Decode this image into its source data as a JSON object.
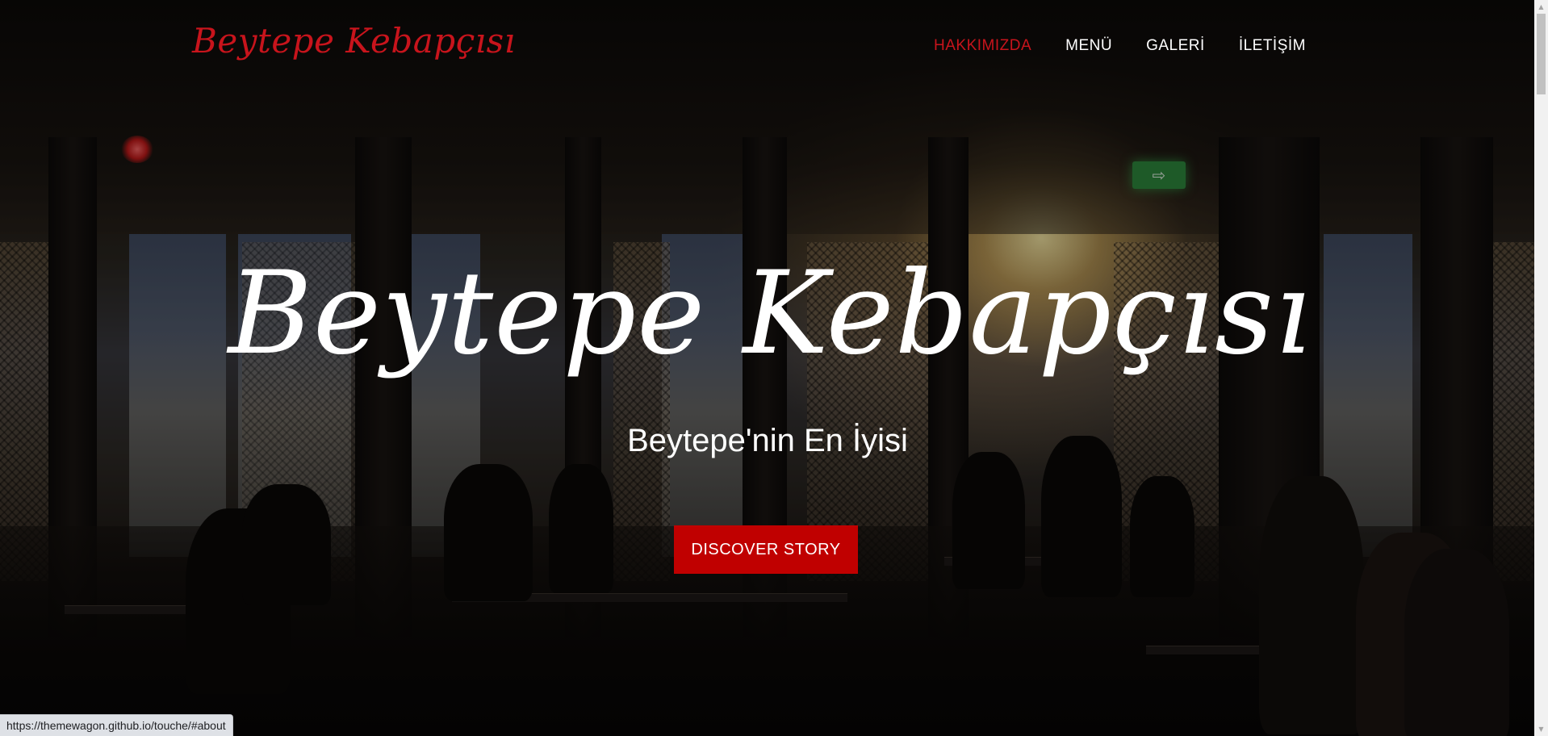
{
  "brand": {
    "name": "Beytepe Kebapçısı"
  },
  "nav": {
    "items": [
      {
        "label": "HAKKIMIZDA",
        "active": true
      },
      {
        "label": "MENÜ",
        "active": false
      },
      {
        "label": "GALERİ",
        "active": false
      },
      {
        "label": "İLETİŞİM",
        "active": false
      }
    ]
  },
  "hero": {
    "title": "Beytepe Kebapçısı",
    "subtitle": "Beytepe'nin En İyisi",
    "cta_label": "DISCOVER STORY"
  },
  "status_bar": {
    "url": "https://themewagon.github.io/touche/#about"
  },
  "colors": {
    "accent": "#c8141c",
    "button": "#c00000",
    "text": "#ffffff"
  }
}
